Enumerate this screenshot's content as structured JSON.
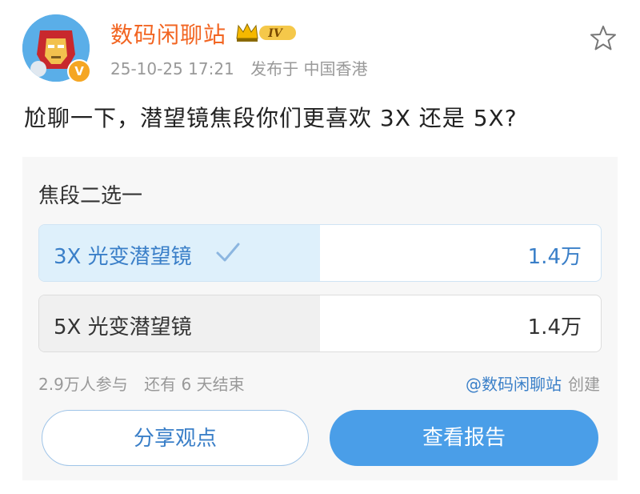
{
  "post": {
    "username": "数码闲聊站",
    "badge_level": "IV",
    "timestamp": "25-10-25 17:21",
    "location": "发布于 中国香港",
    "text": "尬聊一下，潜望镜焦段你们更喜欢 3X 还是 5X?",
    "verify_mark": "V"
  },
  "poll": {
    "title": "焦段二选一",
    "options": [
      {
        "label": "3X 光变潜望镜",
        "count": "1.4万",
        "selected": true,
        "share": 0.52
      },
      {
        "label": "5X 光变潜望镜",
        "count": "1.4万",
        "selected": false,
        "share": 0.5
      }
    ],
    "participants": "2.9万人参与",
    "remaining": "还有 6 天结束",
    "creator_link": "@数码闲聊站",
    "creator_suffix": "创建",
    "share_button": "分享观点",
    "report_button": "查看报告"
  },
  "colors": {
    "username": "#f26522",
    "accent": "#3a7fc8",
    "button_primary": "#4a9ee8",
    "selected_fill": "#def0fb"
  },
  "icons": {
    "star": "star-outline-icon",
    "check": "check-icon",
    "crown": "crown-icon",
    "verify": "verified-icon"
  }
}
